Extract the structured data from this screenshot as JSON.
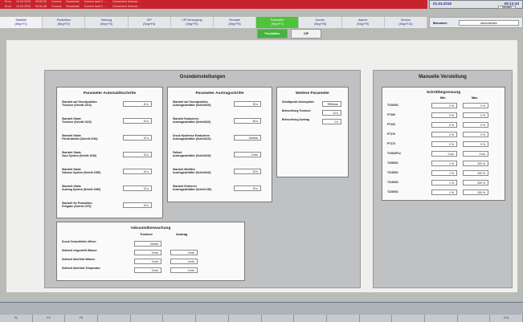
{
  "alarms": [
    [
      "Error",
      "10.03.2015",
      "09:52:33",
      "Comms",
      "Broadcast",
      "Comms fault 3 - ...",
      "Connection timeout..."
    ],
    [
      "Error",
      "10.03.2015",
      "09:51:08",
      "Comms",
      "Broadcast",
      "Comms fault 2 - ...",
      "Connection timeout..."
    ]
  ],
  "header": {
    "date": "01.03.2015",
    "time": "09:13:33",
    "druck_label": "Drucken",
    "user_label": "Benutzer:",
    "user_value": "administrator"
  },
  "nav": [
    {
      "label": "Startbild\n(Strg+F1)"
    },
    {
      "label": "Produktion\n(Strg+F2)"
    },
    {
      "label": "Heizung\n(Strg+F3)"
    },
    {
      "label": "CIP\n(Strg+F4)"
    },
    {
      "label": "CIP Versorgung\n(Strg+F5)"
    },
    {
      "label": "Rezepte\n(Strg+F6)"
    },
    {
      "label": "Parameter\n(Strg+F7)",
      "active": true
    },
    {
      "label": "Kurven\n(Strg+F8)"
    },
    {
      "label": "Alarme\n(Strg+F9)"
    },
    {
      "label": "Service\n(Strg+F10)"
    }
  ],
  "subtabs": [
    "Produktion",
    "CIP"
  ],
  "grund": {
    "title": "Grundeinstellungen",
    "auto": {
      "title": "Parameter Automatikschritte",
      "rows": [
        {
          "label": "Startzeit auf Grundposition\nTrockner (Schritt 1010)",
          "value": "10 s"
        },
        {
          "label": "Startzeit Starte\nTrockner (Schritt 1020)",
          "value": "10 s"
        },
        {
          "label": "Startzeit Starte\nFörderbänder (Schritt 1030)",
          "value": "10 s"
        },
        {
          "label": "Startzeit Starte\nVacc System (Schritt 1040)",
          "value": "10 s"
        },
        {
          "label": "Startzeit Starte\nVakuum System (Schritt 1050)",
          "value": "10 s"
        },
        {
          "label": "Startzeit Starte\nAustrag System (Schritt 1060)",
          "value": "10 s"
        },
        {
          "label": "Startzeit für Produktion\nFreigabe (Schritt 1070)",
          "value": "10 s"
        }
      ]
    },
    "austrag": {
      "title": "Parameter Austragschritte",
      "rows": [
        {
          "label": "Startzeit auf Grundposition\nAustragsbehälter (Schritt100)",
          "value": "30 s"
        },
        {
          "label": "Startzeit Evakuieren\nAustragsbehälter (Schritt110)",
          "value": "60 s"
        },
        {
          "label": "Druck Hysterese Evakuieren\nAustragsbehälter (Schritt120)",
          "value": "10mbar"
        },
        {
          "label": "Fallzeit\nAustragsbehälter (Schritt130)",
          "value": "2 min"
        },
        {
          "label": "Startzeit Belüften\nAustragsbehälter (Schritt140)",
          "value": "20 s"
        },
        {
          "label": "Startzeit Entleeren\nAustragsbehälter (Schritt 150)",
          "value": "30 s"
        }
      ]
    },
    "weitere": {
      "title": "Weitere Parameter",
      "rows": [
        {
          "label": "Schaltpunkt Atmosphäre",
          "value": "999mbar"
        },
        {
          "label": "Beleuchtung Trockner",
          "value": "10 s"
        },
        {
          "label": "Beleuchtung Austrag",
          "value": "0 s"
        }
      ]
    },
    "vakuum": {
      "title": "Vakuumüberwachung",
      "col1": "Trockner",
      "col2": "Austrag",
      "rows": [
        {
          "label": "Druck Sensorfehler öffnen",
          "v1": "0mbar",
          "v2": ""
        },
        {
          "label": "Sollwert eingestellt Wasser",
          "v1": "0 min",
          "v2": "0 min"
        },
        {
          "label": "Sollwert überhitzt Wasser",
          "v1": "0 min",
          "v2": "0 min"
        },
        {
          "label": "Sollwert überhitzt Temperatur",
          "v1": "0 min",
          "v2": "0 min"
        }
      ]
    }
  },
  "manuell": {
    "title": "Manuelle Verstellung",
    "box_title": "Schrittbegrenzung",
    "col_min": "Min",
    "col_max": "Max",
    "rows": [
      {
        "label": "TV20001",
        "min": "0 %",
        "max": "0 %"
      },
      {
        "label": "PT100",
        "min": "0 %",
        "max": "0 %"
      },
      {
        "label": "PT103",
        "min": "0 %",
        "max": "0 %"
      },
      {
        "label": "PT170",
        "min": "0 %",
        "max": "0 %"
      },
      {
        "label": "PT172",
        "min": "0 %",
        "max": "0 %"
      },
      {
        "label": "TV20UP14",
        "min": "0 cm",
        "max": "0 cm"
      },
      {
        "label": "T20S001",
        "min": "1 %",
        "max": "200 %"
      },
      {
        "label": "T21S001",
        "min": "1 %",
        "max": "200 %"
      },
      {
        "label": "T21S002",
        "min": "1 %",
        "max": "200 %"
      },
      {
        "label": "T22S001",
        "min": "1 %",
        "max": "200 %"
      }
    ]
  },
  "fkeys": [
    "F1",
    "F2",
    "F3",
    "",
    "",
    "",
    "",
    "",
    "",
    "",
    "",
    "",
    "",
    "",
    "",
    "F13"
  ]
}
